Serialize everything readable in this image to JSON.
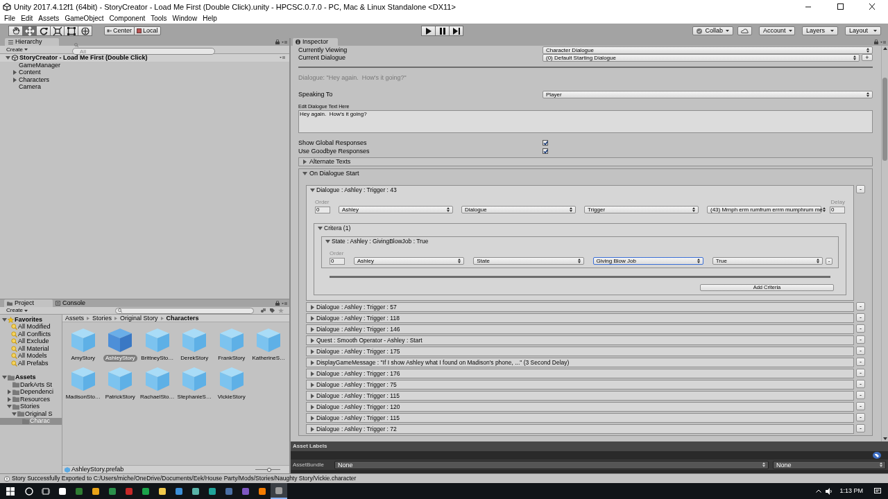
{
  "window": {
    "title": "Unity 2017.4.12f1 (64bit) - StoryCreator - Load Me First (Double Click).unity - HPCSC.0.7.0 - PC, Mac & Linux Standalone <DX11>"
  },
  "menu": [
    "File",
    "Edit",
    "Assets",
    "GameObject",
    "Component",
    "Tools",
    "Window",
    "Help"
  ],
  "toolbar": {
    "tools": [
      {
        "kind": "hand",
        "selected": false
      },
      {
        "kind": "move",
        "selected": true
      },
      {
        "kind": "rotate",
        "selected": false
      },
      {
        "kind": "scale",
        "selected": false
      },
      {
        "kind": "rect",
        "selected": false
      },
      {
        "kind": "transform",
        "selected": false
      }
    ],
    "pivot": [
      "Center",
      "Local"
    ],
    "right": [
      {
        "kind": "collab",
        "label": "Collab"
      },
      {
        "kind": "cloud"
      },
      {
        "kind": "menu",
        "label": "Account"
      },
      {
        "kind": "menu",
        "label": "Layers"
      },
      {
        "kind": "menu",
        "label": "Layout"
      }
    ]
  },
  "hierarchy": {
    "tab": "Hierarchy",
    "create": "Create",
    "search_placeholder": "All",
    "scene": "StoryCreator - Load Me First (Double Click)",
    "items": [
      {
        "label": "GameManager",
        "kind": "leaf"
      },
      {
        "label": "Content",
        "kind": "group"
      },
      {
        "label": "Characters",
        "kind": "group"
      },
      {
        "label": "Camera",
        "kind": "leaf"
      }
    ]
  },
  "project": {
    "tabs": [
      {
        "label": "Project",
        "selected": true
      },
      {
        "label": "Console",
        "selected": false
      }
    ],
    "create": "Create",
    "favorites": {
      "label": "Favorites",
      "expanded": true,
      "children": [
        {
          "label": "All Modified"
        },
        {
          "label": "All Conflicts"
        },
        {
          "label": "All Exclude"
        },
        {
          "label": "All Material"
        },
        {
          "label": "All Models"
        },
        {
          "label": "All Prefabs"
        }
      ]
    },
    "assets": {
      "label": "Assets",
      "expanded": true,
      "selected": false,
      "children": [
        {
          "label": "DarkArts St",
          "selected": false
        },
        {
          "label": "Dependenci",
          "expanded": false,
          "selected": false
        },
        {
          "label": "Resources",
          "expanded": false,
          "selected": false
        },
        {
          "label": "Stories",
          "expanded": true,
          "selected": false,
          "children": [
            {
              "label": "Original S",
              "expanded": true,
              "selected": false,
              "children": [
                {
                  "label": "Charac",
                  "selected": true
                }
              ]
            }
          ]
        }
      ]
    },
    "breadcrumb": [
      "Assets",
      "Stories",
      "Original Story",
      "Characters"
    ],
    "files": [
      {
        "label": "AmyStory",
        "selected": false
      },
      {
        "label": "AshleyStory",
        "selected": true
      },
      {
        "label": "BrittneySto…",
        "selected": false
      },
      {
        "label": "DerekStory",
        "selected": false
      },
      {
        "label": "FrankStory",
        "selected": false
      },
      {
        "label": "KatherineS…",
        "selected": false
      },
      {
        "label": "MadisonSto…",
        "selected": false
      },
      {
        "label": "PatrickStory",
        "selected": false
      },
      {
        "label": "RachaelSto…",
        "selected": false
      },
      {
        "label": "StephanieS…",
        "selected": false
      },
      {
        "label": "VickieStory",
        "selected": false
      }
    ],
    "footer": "AshleyStory.prefab",
    "zoom_slider": {
      "level": 0.55
    }
  },
  "inspector": {
    "tab": "Inspector",
    "currently_viewing": {
      "label": "Currently Viewing",
      "value": "Character Dialogue"
    },
    "current_dialogue": {
      "label": "Current Dialogue",
      "value": "(0) Default Starting Dialogue",
      "add": "+"
    },
    "preview": "Dialogue: \"Hey again.  How's it going?\"",
    "speaking_to": {
      "label": "Speaking To",
      "value": "Player"
    },
    "edit_text": {
      "label": "Edit Dialogue Text Here",
      "value": "Hey again.  How's it going?"
    },
    "toggles": [
      {
        "label": "Show Global Responses",
        "checked": true
      },
      {
        "label": "Use Goodbye Responses",
        "checked": true
      }
    ],
    "alternate_texts": {
      "label": "Alternate Texts",
      "expanded": false
    },
    "on_dialogue_start": {
      "label": "On Dialogue Start",
      "expanded": true,
      "events": [
        {
          "title": "Dialogue : Ashley : Trigger : 43",
          "expanded": true,
          "remove": "-",
          "order_label": "Order",
          "order": "0",
          "selects": [
            "Ashley",
            "Dialogue",
            "Trigger",
            "(43) Mrnph erm rumfrum errm mumphrum me"
          ],
          "delay_label": "Delay",
          "delay": "0",
          "criteria": {
            "title": "Critera (1)",
            "expanded": true,
            "add_button": "Add Criteria",
            "items": [
              {
                "title": "State : Ashley : GivingBlowJob : True",
                "expanded": true,
                "order_label": "Order",
                "order": "0",
                "remove": "-",
                "selects": [
                  {
                    "value": "Ashley",
                    "focused": false
                  },
                  {
                    "value": "State",
                    "focused": false
                  },
                  {
                    "value": "Giving Blow Job",
                    "focused": true
                  },
                  {
                    "value": "True",
                    "focused": false
                  }
                ]
              }
            ]
          }
        },
        {
          "title": "Dialogue : Ashley : Trigger : 57",
          "expanded": false,
          "remove": "-"
        },
        {
          "title": "Dialogue : Ashley : Trigger : 118",
          "expanded": false,
          "remove": "-"
        },
        {
          "title": "Dialogue : Ashley : Trigger : 146",
          "expanded": false,
          "remove": "-"
        },
        {
          "title": "Quest : Smooth Operator - Ashley : Start",
          "expanded": false,
          "remove": "-"
        },
        {
          "title": "Dialogue : Ashley : Trigger : 175",
          "expanded": false,
          "remove": "-"
        },
        {
          "title": "DisplayGameMessage : \"If I show Ashley what I found on Madison's phone, ...\" (3 Second Delay)",
          "expanded": false,
          "remove": "-"
        },
        {
          "title": "Dialogue : Ashley : Trigger : 176",
          "expanded": false,
          "remove": "-"
        },
        {
          "title": "Dialogue : Ashley : Trigger : 75",
          "expanded": false,
          "remove": "-"
        },
        {
          "title": "Dialogue : Ashley : Trigger : 115",
          "expanded": false,
          "remove": "-"
        },
        {
          "title": "Dialogue : Ashley : Trigger : 120",
          "expanded": false,
          "remove": "-"
        },
        {
          "title": "Dialogue : Ashley : Trigger : 115",
          "expanded": false,
          "remove": "-"
        },
        {
          "title": "Dialogue : Ashley : Trigger : 72",
          "expanded": false,
          "remove": "-"
        }
      ]
    }
  },
  "asset_labels": {
    "title": "Asset Labels",
    "bundle_label": "AssetBundle",
    "bundle": "None",
    "variant": "None"
  },
  "status_bar": "Story Successfully Exported to C:/Users/miche/OneDrive/Documents/Eek/House Party/Mods/Stories/Naughty Story/Vickie.character",
  "taskbar": {
    "clock": "1:13 PM"
  }
}
